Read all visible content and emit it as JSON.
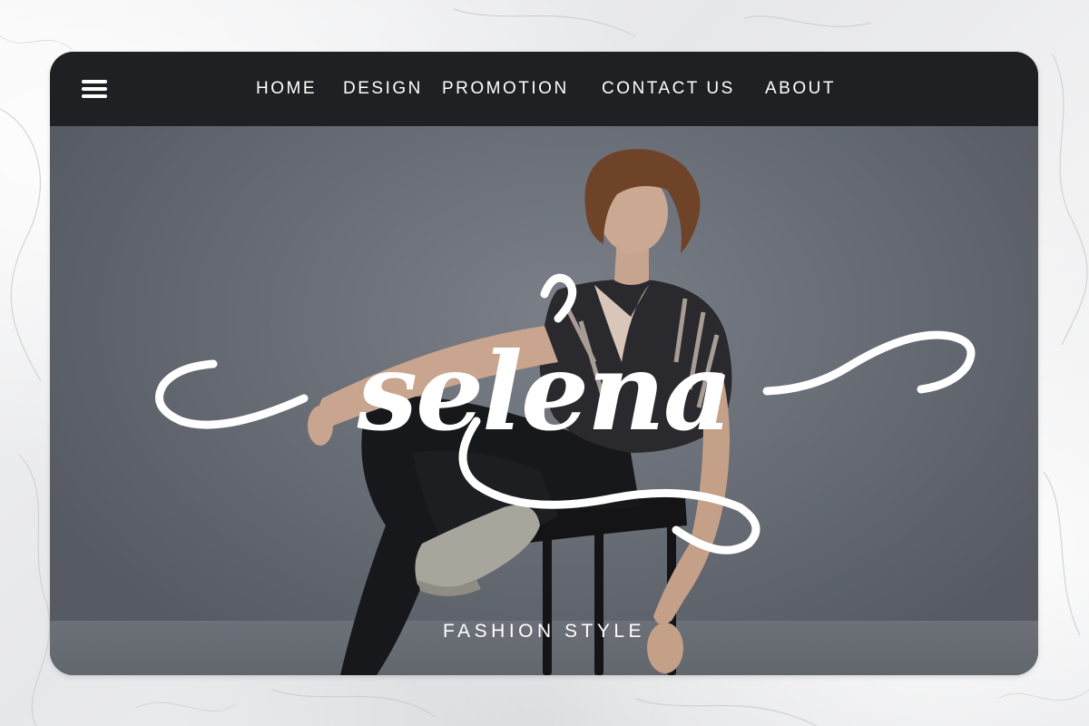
{
  "nav": {
    "menu_icon": "hamburger-menu-icon",
    "links": [
      {
        "label": "HOME"
      },
      {
        "label": "DESIGN"
      },
      {
        "label": "PROMOTION"
      },
      {
        "label": "CONTACT US"
      },
      {
        "label": "ABOUT"
      }
    ]
  },
  "hero": {
    "logo_text": "selena",
    "tagline": "FASHION STYLE"
  },
  "colors": {
    "navbar": "#1f2023",
    "hero_background": "#6a6f78",
    "text": "#ffffff",
    "page_background": "#ecedef"
  }
}
